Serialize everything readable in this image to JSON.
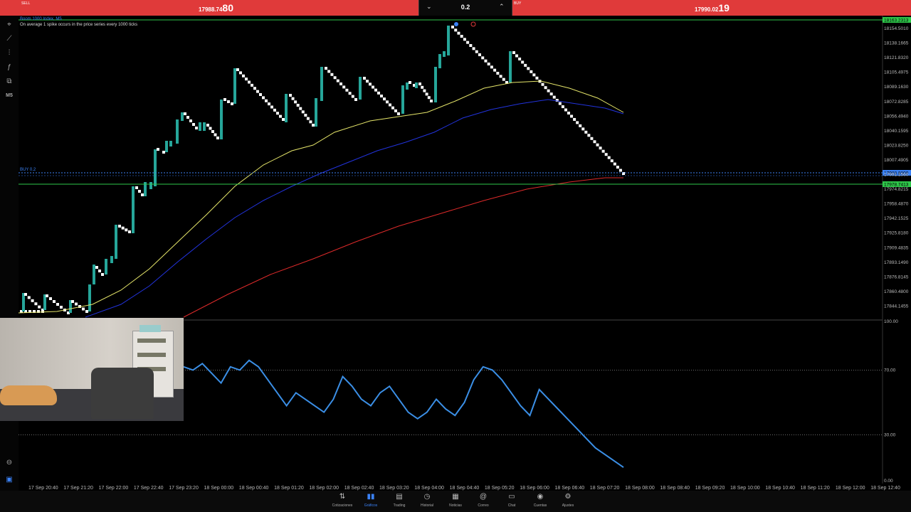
{
  "trade_bar": {
    "sell_label": "SELL",
    "sell_price_small": "17988.74",
    "sell_price_big": "80",
    "lot_size": "0.2",
    "buy_label": "BUY",
    "buy_price_small": "17990.02",
    "buy_price_big": "19"
  },
  "chart": {
    "symbol_line": "Boom 1000 Index, M5",
    "info_line": "On average 1 spike occurs in the price series every 1000 ticks",
    "position_tag": "BUY 0.2",
    "current_price_tag": "17988.8800",
    "top_price_tag": "18163.2313",
    "green_price_tag": "17978.7413",
    "price_axis": [
      "18154.5010",
      "18138.1665",
      "18121.8320",
      "18105.4975",
      "18089.1630",
      "18072.8285",
      "18056.4940",
      "18040.1595",
      "18023.8250",
      "18007.4905",
      "17991.1560",
      "17974.8215",
      "17958.4870",
      "17942.1525",
      "17925.8180",
      "17909.4835",
      "17893.1490",
      "17876.8145",
      "17860.4800",
      "17844.1455"
    ],
    "osc_axis": [
      "100.00",
      "70.00",
      "30.00",
      "0.00"
    ],
    "time_axis": [
      "17 Sep 20:40",
      "17 Sep 21:20",
      "17 Sep 22:00",
      "17 Sep 22:40",
      "17 Sep 23:20",
      "18 Sep 00:00",
      "18 Sep 00:40",
      "18 Sep 01:20",
      "18 Sep 02:00",
      "18 Sep 02:40",
      "18 Sep 03:20",
      "18 Sep 04:00",
      "18 Sep 04:40",
      "18 Sep 05:20",
      "18 Sep 06:00",
      "18 Sep 06:40",
      "18 Sep 07:20",
      "18 Sep 08:00",
      "18 Sep 08:40",
      "18 Sep 09:20",
      "18 Sep 10:00",
      "18 Sep 10:40",
      "18 Sep 11:20",
      "18 Sep 12:00",
      "18 Sep 12:40"
    ],
    "timeframe": "M5",
    "colors": {
      "bull": "#26a69a",
      "bear": "#ffffff",
      "ma_fast": "#e6e66a",
      "ma_mid": "#2233dd",
      "ma_slow": "#dd2a2a",
      "osc": "#3b8fe6",
      "level": "#2ec84a"
    }
  },
  "chart_data": {
    "type": "candlestick",
    "symbol": "Boom 1000 Index",
    "timeframe": "M5",
    "price_range": [
      17835,
      18165
    ],
    "oscillator_range": [
      0,
      100
    ],
    "oscillator_levels": [
      70,
      30
    ],
    "horizontal_levels": [
      18163.2313,
      17978.7413,
      17988.88
    ],
    "oscillator_values": [
      72,
      70,
      74,
      68,
      62,
      72,
      70,
      76,
      72,
      64,
      56,
      48,
      56,
      52,
      48,
      44,
      52,
      66,
      60,
      52,
      48,
      56,
      60,
      52,
      44,
      40,
      44,
      52,
      46,
      42,
      50,
      64,
      72,
      70,
      64,
      56,
      48,
      42,
      58,
      52,
      46,
      40,
      34,
      28,
      22,
      18,
      14,
      10
    ]
  },
  "nav": [
    {
      "label": "Cotizaciones",
      "icon": "⇅"
    },
    {
      "label": "Gráficos",
      "icon": "▮▮"
    },
    {
      "label": "Trading",
      "icon": "▤"
    },
    {
      "label": "Historial",
      "icon": "◷"
    },
    {
      "label": "Noticias",
      "icon": "▦"
    },
    {
      "label": "Correo",
      "icon": "@"
    },
    {
      "label": "Chat",
      "icon": "▭"
    },
    {
      "label": "Cuentas",
      "icon": "◉"
    },
    {
      "label": "Ajustes",
      "icon": "⚙"
    }
  ]
}
